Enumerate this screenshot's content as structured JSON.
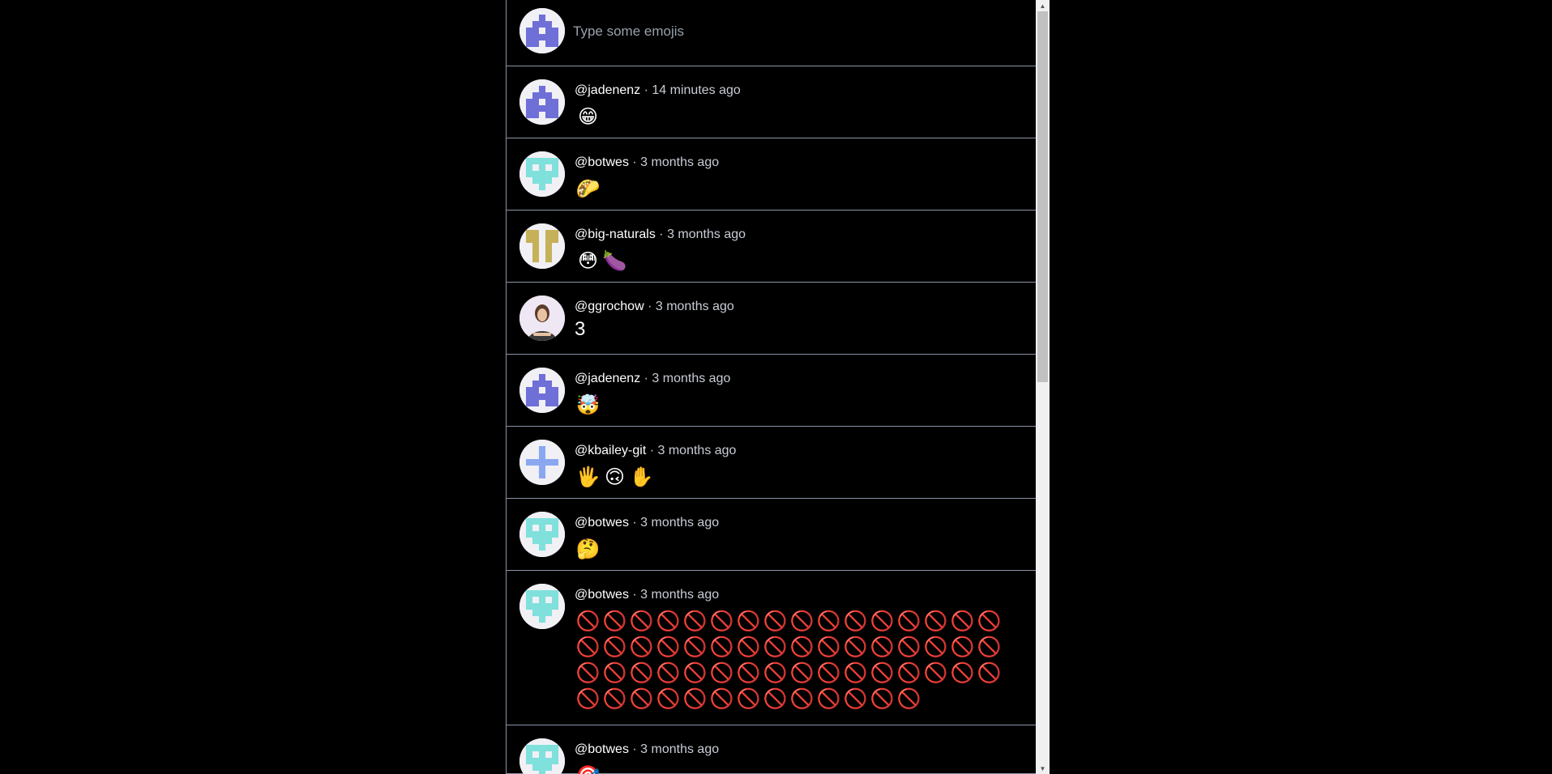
{
  "compose": {
    "placeholder": "Type some emojis"
  },
  "separator": " · ",
  "posts": [
    {
      "handle": "@jadenenz",
      "time": "14 minutes ago",
      "avatar": "purple",
      "emojis": [
        "😁"
      ]
    },
    {
      "handle": "@botwes",
      "time": "3 months ago",
      "avatar": "teal",
      "emojis": [
        "🌮"
      ]
    },
    {
      "handle": "@big-naturals",
      "time": "3 months ago",
      "avatar": "gold",
      "emojis": [
        "😳",
        "🍆"
      ]
    },
    {
      "handle": "@ggrochow",
      "time": "3 months ago",
      "avatar": "photo",
      "text": "3"
    },
    {
      "handle": "@jadenenz",
      "time": "3 months ago",
      "avatar": "purple",
      "emojis": [
        "🤯"
      ]
    },
    {
      "handle": "@kbailey-git",
      "time": "3 months ago",
      "avatar": "blue",
      "emojis": [
        "🖐",
        "🙃",
        "✋"
      ]
    },
    {
      "handle": "@botwes",
      "time": "3 months ago",
      "avatar": "teal",
      "emojis": [
        "🤔"
      ]
    },
    {
      "handle": "@botwes",
      "time": "3 months ago",
      "avatar": "teal",
      "emojis": [
        "🚫",
        "🚫",
        "🚫",
        "🚫",
        "🚫",
        "🚫",
        "🚫",
        "🚫",
        "🚫",
        "🚫",
        "🚫",
        "🚫",
        "🚫",
        "🚫",
        "🚫",
        "🚫",
        "🚫",
        "🚫",
        "🚫",
        "🚫",
        "🚫",
        "🚫",
        "🚫",
        "🚫",
        "🚫",
        "🚫",
        "🚫",
        "🚫",
        "🚫",
        "🚫",
        "🚫",
        "🚫",
        "🚫",
        "🚫",
        "🚫",
        "🚫",
        "🚫",
        "🚫",
        "🚫",
        "🚫",
        "🚫",
        "🚫",
        "🚫",
        "🚫",
        "🚫",
        "🚫",
        "🚫",
        "🚫",
        "🚫",
        "🚫",
        "🚫",
        "🚫",
        "🚫",
        "🚫",
        "🚫",
        "🚫",
        "🚫",
        "🚫",
        "🚫",
        "🚫",
        "🚫"
      ]
    },
    {
      "handle": "@botwes",
      "time": "3 months ago",
      "avatar": "teal",
      "emojis": [
        "🎯"
      ]
    }
  ],
  "colors": {
    "purple": "#6f6fd8",
    "teal": "#7fe0dc",
    "gold": "#c6b15a",
    "blue": "#8aa8f0",
    "divider": "#8b93a8"
  }
}
